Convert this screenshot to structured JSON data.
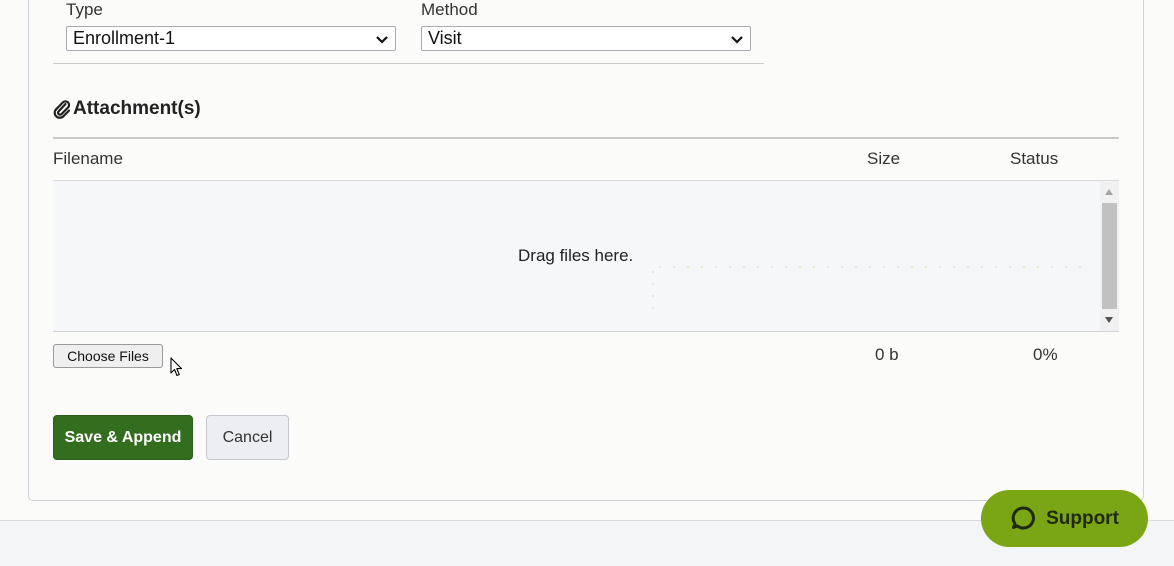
{
  "form": {
    "type_label": "Type",
    "type_value": "Enrollment-1",
    "method_label": "Method",
    "method_value": "Visit"
  },
  "attachments": {
    "title": "Attachment(s)",
    "columns": {
      "filename": "Filename",
      "size": "Size",
      "status": "Status"
    },
    "drop_text": "Drag files here.",
    "choose_files_label": "Choose Files",
    "total_size": "0 b",
    "progress": "0%"
  },
  "actions": {
    "save_label": "Save & Append",
    "cancel_label": "Cancel"
  },
  "support": {
    "label": "Support"
  },
  "icons": {
    "attachment": "paperclip-icon",
    "support": "chat-bubble-icon",
    "select_arrow": "chevron-down-icon"
  },
  "colors": {
    "primary": "#336e1f",
    "support": "#7aa514"
  }
}
